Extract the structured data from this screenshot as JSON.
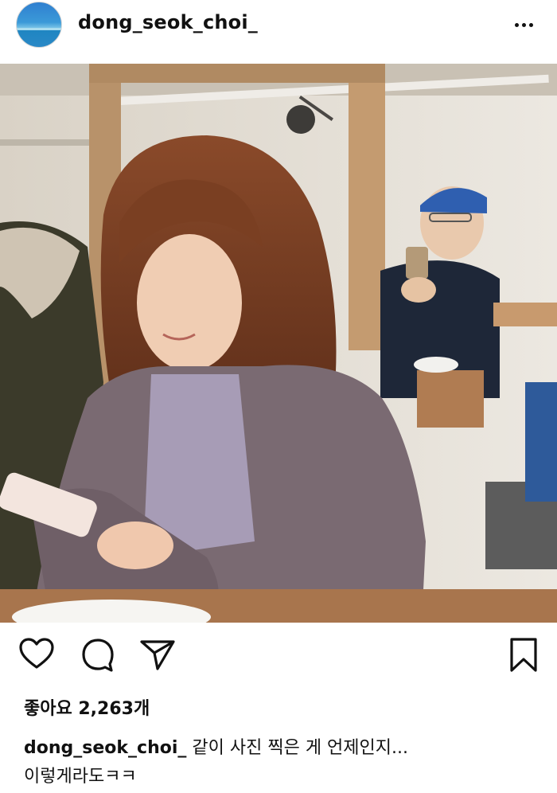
{
  "post": {
    "username": "dong_seok_choi_",
    "likes_text": "좋아요 2,263개",
    "caption_username": "dong_seok_choi_",
    "caption_line1": "같이 사진 찍은 게 언제인지...",
    "caption_line2": "이렇게라도ㅋㅋ"
  },
  "icons": {
    "more": "more-options-icon",
    "like": "heart-icon",
    "comment": "comment-icon",
    "share": "send-icon",
    "save": "bookmark-icon"
  },
  "colors": {
    "text": "#111111",
    "background": "#ffffff"
  }
}
